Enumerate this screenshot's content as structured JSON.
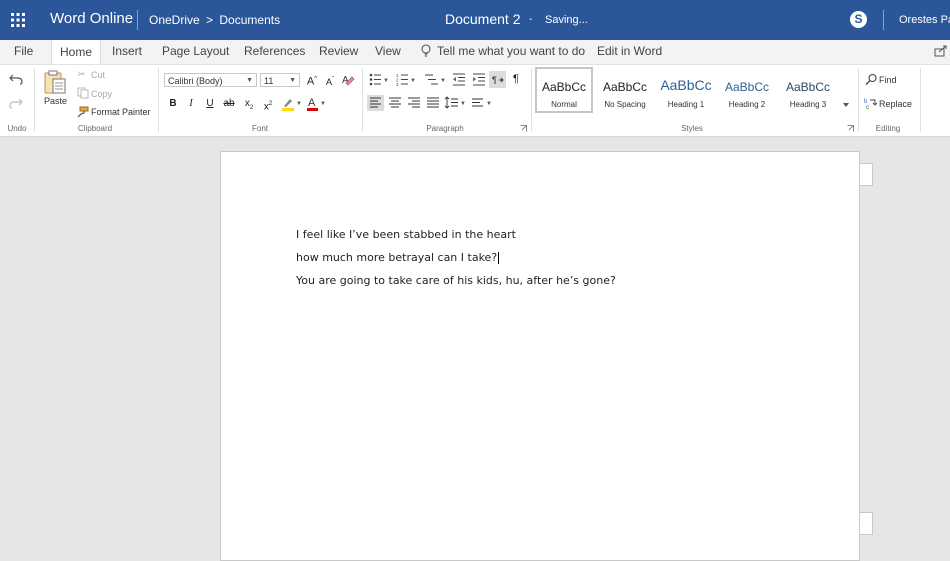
{
  "header": {
    "app_name": "Word Online",
    "breadcrumb": [
      "OneDrive",
      ">",
      "Documents"
    ],
    "document_title": "Document 2",
    "separator": "-",
    "status": "Saving...",
    "user_name": "Orestes Pa",
    "bar_color": "#2b579a"
  },
  "tabs": [
    "File",
    "Home",
    "Insert",
    "Page Layout",
    "References",
    "Review",
    "View"
  ],
  "active_tab": "Home",
  "tell_me": "Tell me what you want to do",
  "edit_in_word": "Edit in Word",
  "ribbon": {
    "undo_group": "Undo",
    "clipboard": {
      "paste": "Paste",
      "cut": "Cut",
      "copy": "Copy",
      "format_painter": "Format Painter",
      "group": "Clipboard"
    },
    "font": {
      "name": "Calibri (Body)",
      "size": "11",
      "grow": "A",
      "shrink": "A",
      "bold": "B",
      "italic": "I",
      "underline": "U",
      "strike": "ab",
      "subscript": "x",
      "superscript": "x",
      "sub_mark": "2",
      "sup_mark": "2",
      "color_a": "A",
      "group": "Font"
    },
    "paragraph": {
      "group": "Paragraph",
      "pilcrow": "¶"
    },
    "styles": {
      "items": [
        {
          "sample": "AaBbCc",
          "name": "Normal"
        },
        {
          "sample": "AaBbCc",
          "name": "No Spacing"
        },
        {
          "sample": "AaBbCc",
          "name": "Heading 1"
        },
        {
          "sample": "AaBbCc",
          "name": "Heading 2"
        },
        {
          "sample": "AaBbCc",
          "name": "Heading 3"
        }
      ],
      "group": "Styles"
    },
    "editing": {
      "find": "Find",
      "replace": "Replace",
      "group": "Editing"
    }
  },
  "document": {
    "paragraphs": [
      "I feel like I’ve been stabbed in the heart",
      "how much more betrayal can I take?",
      "You are going to take care of his kids, hu, after he’s gone?"
    ]
  }
}
